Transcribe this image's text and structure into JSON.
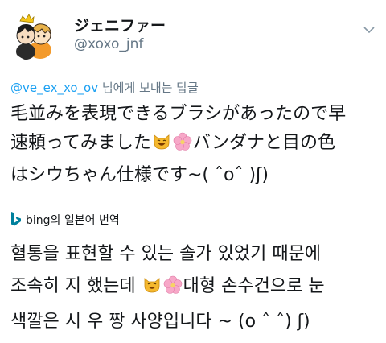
{
  "profile": {
    "display_name": "ジェニファー",
    "handle": "@xoxo_jnf"
  },
  "reply": {
    "mention": "@ve_ex_xo_ov",
    "suffix": " 님에게 보내는 답글"
  },
  "tweet": {
    "line1": "毛並みを表現できるブラシがあったので早",
    "line2_before": "速頼ってみました",
    "line2_after": "バンダナと目の色",
    "line3": "はシウちゃん仕様です~( ˆoˆ )ʃ)"
  },
  "translation": {
    "provider_label": "bing의 일본어 번역",
    "line1": "혈통을 표현할 수 있는 솔가 있었기 때문에",
    "line2_before": "조속히 지 했는데 ",
    "line2_after": "대형 손수건으로 눈",
    "line3": "색깔은 시 우 짱 사양입니다 ~ (o ˆ ˆ) ʃ)"
  },
  "emoji": {
    "cat": "smiling-cat-emoji",
    "flower": "cherry-blossom-emoji"
  },
  "colors": {
    "text": "#14171a",
    "secondary": "#657786",
    "mention": "#1da1f2",
    "bing": "#00809d"
  }
}
